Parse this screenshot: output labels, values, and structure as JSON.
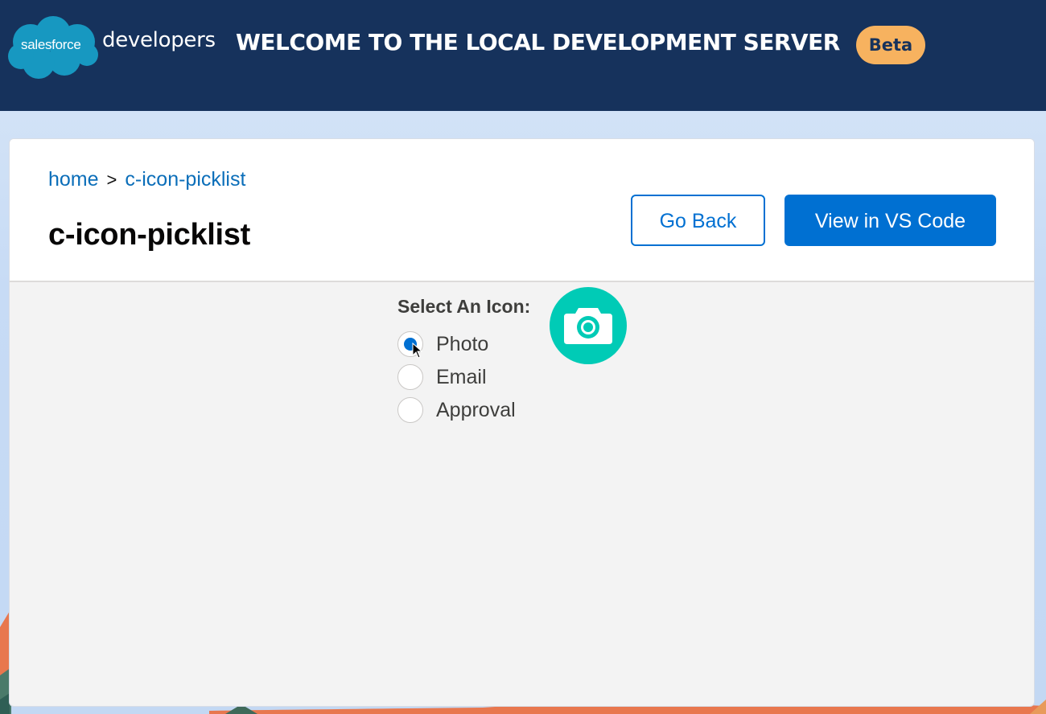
{
  "header": {
    "logo_brand": "salesforce",
    "logo_suffix": "developers",
    "title": "WELCOME TO THE LOCAL DEVELOPMENT SERVER",
    "badge": "Beta"
  },
  "breadcrumb": {
    "home": "home",
    "separator": ">",
    "current": "c-icon-picklist"
  },
  "page": {
    "title": "c-icon-picklist"
  },
  "actions": {
    "go_back": "Go Back",
    "view_code": "View in VS Code"
  },
  "picklist": {
    "label": "Select An Icon:",
    "selected": "Photo",
    "options": [
      {
        "label": "Photo",
        "checked": true
      },
      {
        "label": "Email",
        "checked": false
      },
      {
        "label": "Approval",
        "checked": false
      }
    ],
    "preview_icon": "camera-icon",
    "preview_color": "#00cbb6"
  },
  "colors": {
    "header_bg": "#16325c",
    "brand_blue": "#0070d2",
    "beta_bg": "#f7b25f",
    "link": "#0b6eb9"
  }
}
